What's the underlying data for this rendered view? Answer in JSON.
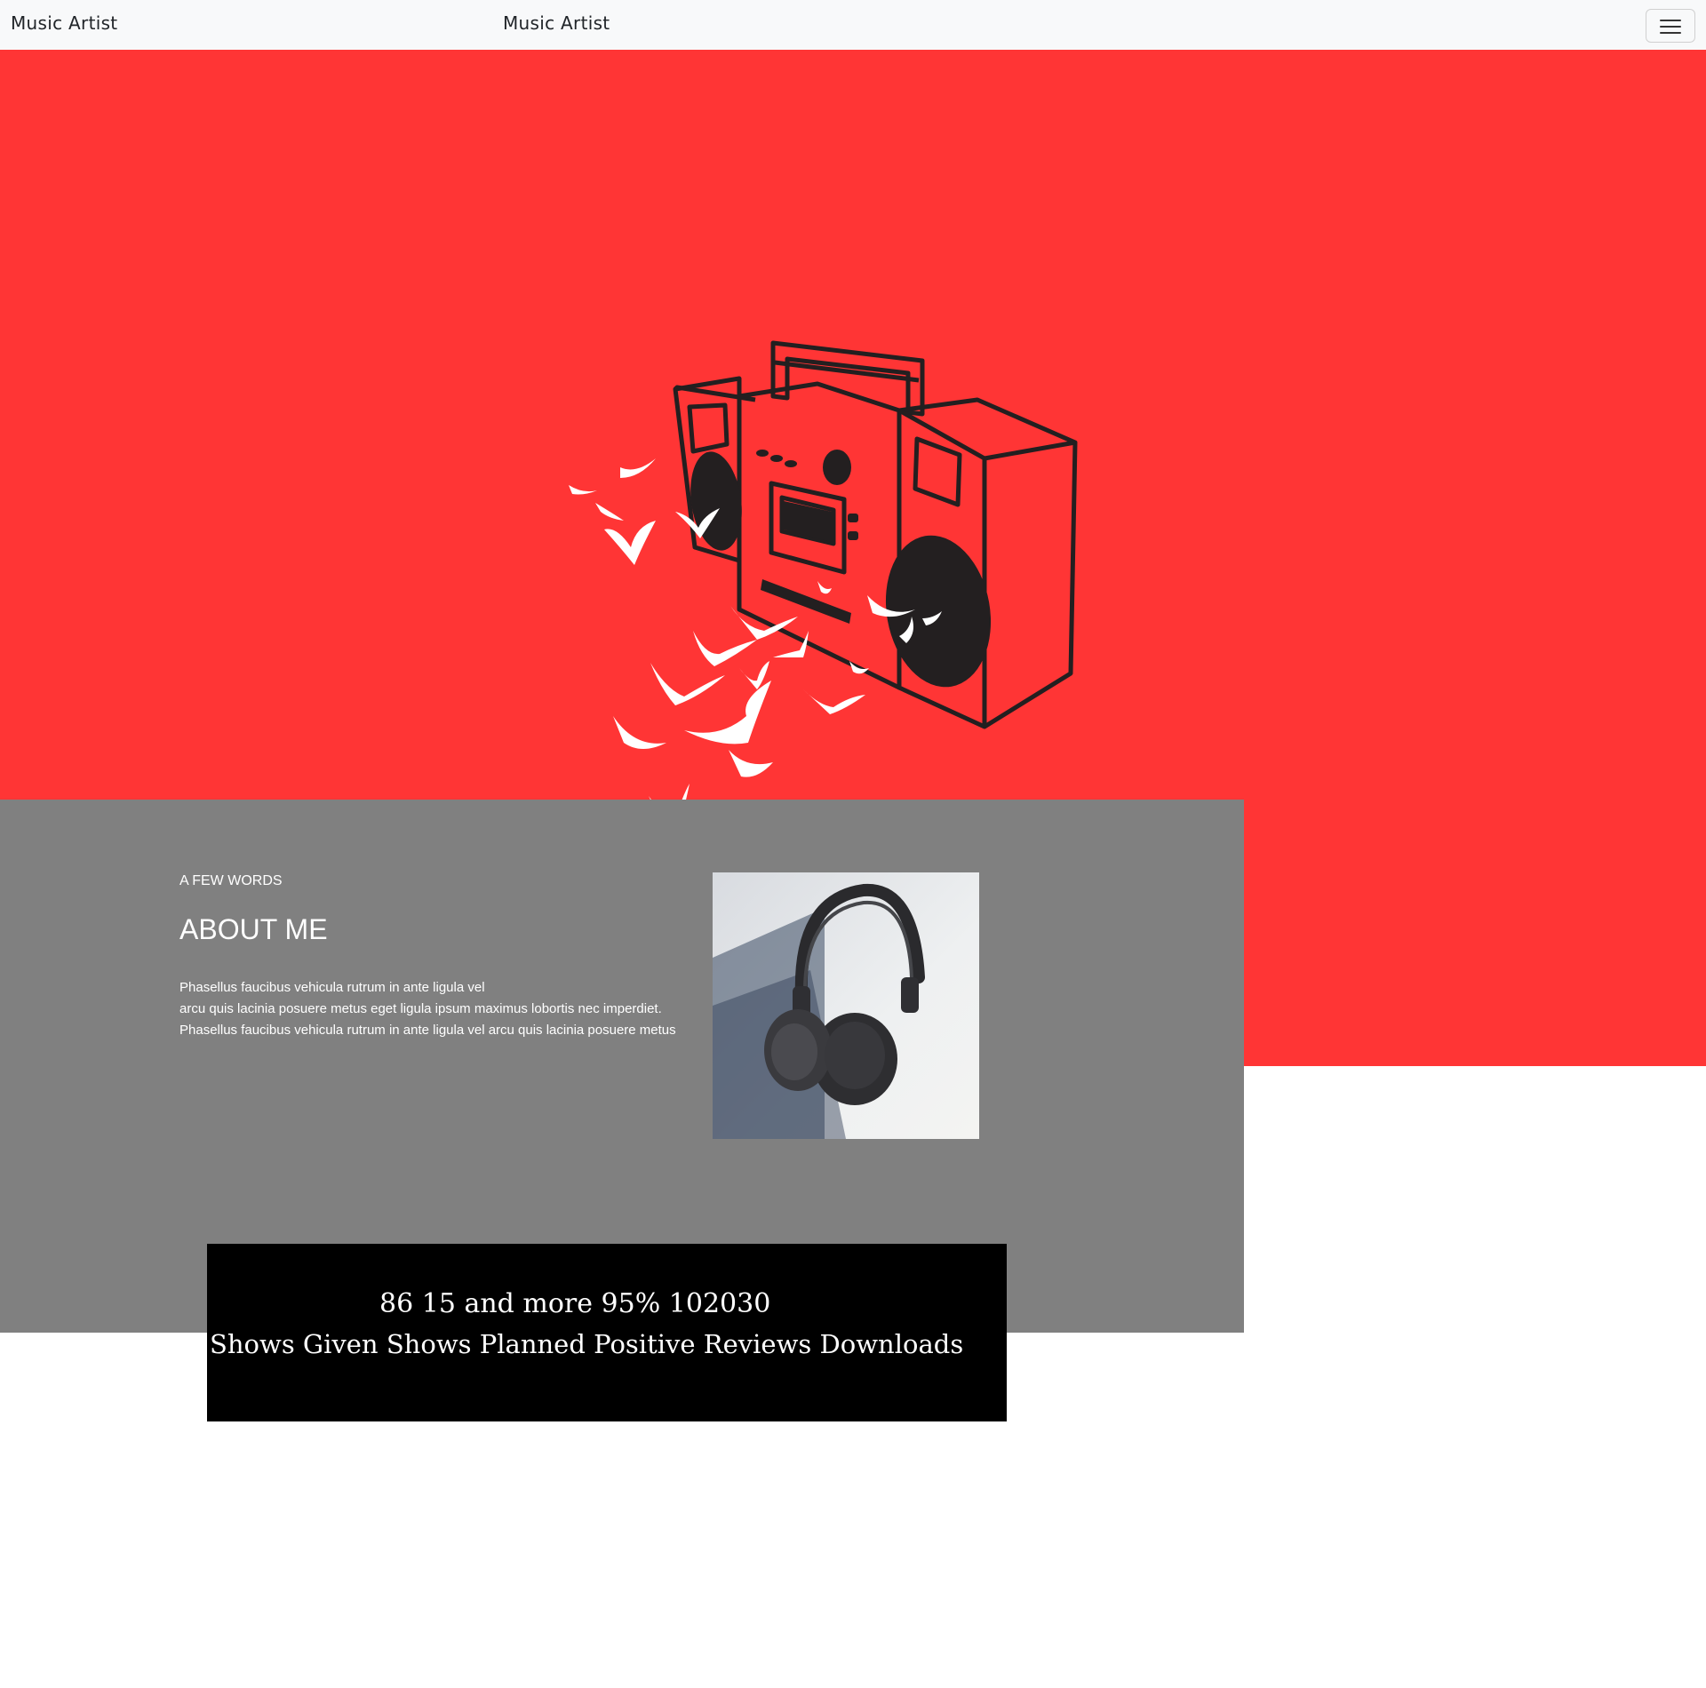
{
  "nav": {
    "brand_left": "Music Artist",
    "brand_center": "Music Artist",
    "toggler_icon": "hamburger-menu-icon"
  },
  "hero": {
    "illustration": "boombox-with-birds",
    "background_color": "#ff3535",
    "art_color": "#231f20",
    "bird_color": "#ffffff"
  },
  "about": {
    "eyebrow": "A FEW WORDS",
    "title": "ABOUT ME",
    "lines": [
      "Phasellus faucibus vehicula rutrum in ante ligula vel",
      "arcu quis lacinia posuere metus eget ligula ipsum maximus lobortis nec imperdiet.",
      "Phasellus faucibus vehicula rutrum in ante ligula vel arcu quis lacinia posuere metus"
    ],
    "image": "headphones-photo",
    "background_color": "#808080"
  },
  "stats": {
    "values": [
      {
        "value": "86"
      },
      {
        "value": "15 and more"
      },
      {
        "value": "95%"
      },
      {
        "value": "102030"
      }
    ],
    "labels": [
      {
        "label": "Shows Given"
      },
      {
        "label": "Shows Planned"
      },
      {
        "label": "Positive Reviews"
      },
      {
        "label": "Downloads"
      }
    ]
  }
}
